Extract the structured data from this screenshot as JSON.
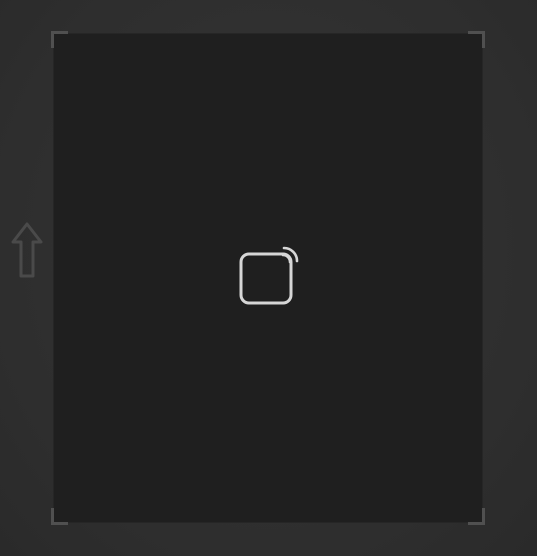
{
  "scene": {
    "background_color": "#2f2f2f",
    "panel_color": "#1f1f1f",
    "corner_color": "#505050",
    "icon_color": "#d6d6d6"
  },
  "left_control": {
    "icon": "up-arrow-icon"
  },
  "center_control": {
    "icon": "cast-icon"
  }
}
